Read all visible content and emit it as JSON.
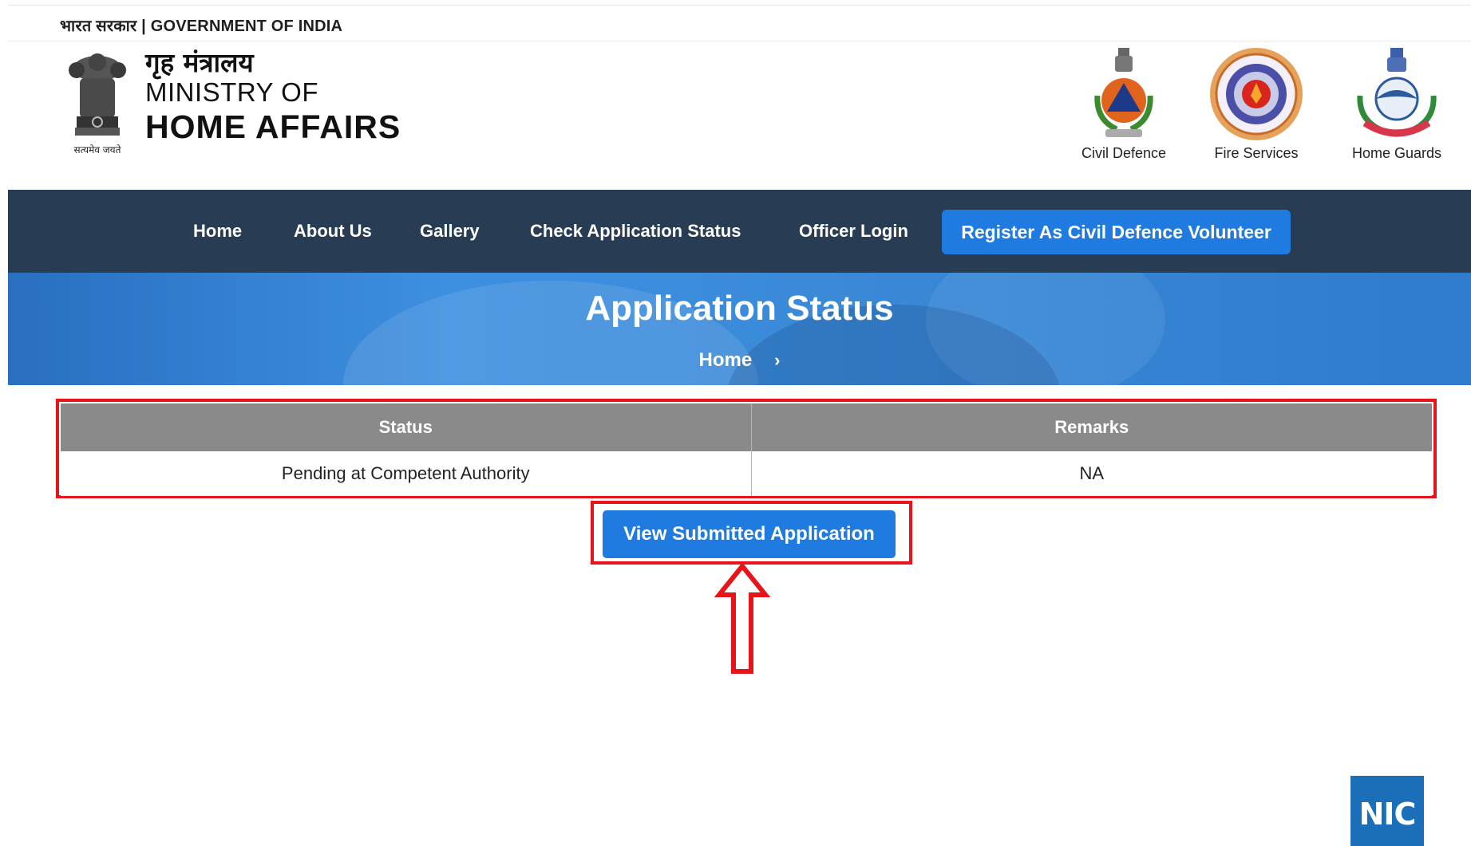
{
  "gov_strip": {
    "text": "भारत सरकार | GOVERNMENT OF INDIA"
  },
  "header": {
    "emblem_icon": "national-emblem-icon",
    "emblem_motto": "सत्यमेव जयते",
    "ministry_hindi": "गृह मंत्रालय",
    "ministry_line1": "MINISTRY OF",
    "ministry_line2": "HOME AFFAIRS",
    "logos": [
      {
        "label": "Civil Defence",
        "icon": "civil-defence-icon"
      },
      {
        "label": "Fire Services",
        "icon": "fire-services-icon"
      },
      {
        "label": "Home Guards",
        "icon": "home-guards-icon"
      }
    ]
  },
  "nav": {
    "items": [
      "Home",
      "About Us",
      "Gallery",
      "Check Application Status",
      "Officer Login"
    ],
    "cta": "Register As Civil Defence Volunteer"
  },
  "banner": {
    "title": "Application Status",
    "breadcrumb": "Home"
  },
  "status_table": {
    "headers": [
      "Status",
      "Remarks"
    ],
    "rows": [
      [
        "Pending at Competent Authority",
        "NA"
      ]
    ]
  },
  "actions": {
    "view_button": "View Submitted Application"
  },
  "footer": {
    "nic_logo": "NIC"
  },
  "colors": {
    "nav_bg": "#283c53",
    "accent": "#1f7be0",
    "highlight": "#e8141a",
    "table_header": "#8a8a8a"
  }
}
